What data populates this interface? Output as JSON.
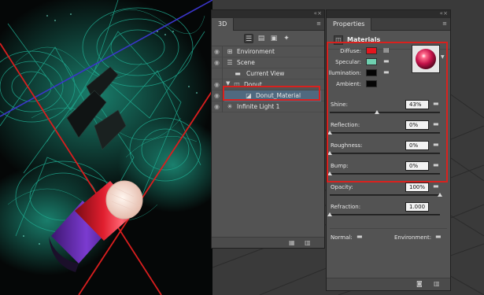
{
  "viewport": {
    "accent_colors": {
      "wire": "#1f9b84",
      "glow": "#2be0bf",
      "axis_red": "#d81e1e",
      "axis_blue": "#3a35c9",
      "can_red": "#d61f30",
      "can_purple": "#6a2db3",
      "cap": "#f1d9cf"
    }
  },
  "panel3d": {
    "tab_label": "3D",
    "collapse_glyph": "«",
    "close_glyph": "×",
    "menu_glyph": "≡",
    "toolbar": [
      {
        "icon": "scene-filter-icon",
        "glyph": "☰",
        "active": true
      },
      {
        "icon": "mesh-filter-icon",
        "glyph": "▤",
        "active": false
      },
      {
        "icon": "material-filter-icon",
        "glyph": "▣",
        "active": false
      },
      {
        "icon": "light-filter-icon",
        "glyph": "✦",
        "active": false
      }
    ],
    "tree": [
      {
        "label": "Environment",
        "icon": "environment-icon",
        "glyph": "⊞"
      },
      {
        "label": "Scene",
        "icon": "scene-icon",
        "glyph": "☰"
      },
      {
        "label": "Current View",
        "icon": "camera-icon",
        "glyph": "▬"
      },
      {
        "label": "Donut",
        "icon": "mesh-icon",
        "glyph": "◫",
        "expanded": true
      },
      {
        "label": "Donut_Material",
        "icon": "material-icon",
        "glyph": "◪",
        "selected": true
      },
      {
        "label": "Infinite Light 1",
        "icon": "infinite-light-icon",
        "glyph": "✳"
      }
    ],
    "footer_icons": [
      "add-light-icon",
      "delete-icon"
    ]
  },
  "properties": {
    "tab_label": "Properties",
    "section_title": "Materials",
    "section_icon": "materials-icon",
    "color_props": [
      {
        "label": "Diffuse:",
        "color": "#e5151d",
        "icon": "texture-loaded-icon"
      },
      {
        "label": "Specular:",
        "color": "#6fd0b0",
        "icon": "folder-icon"
      },
      {
        "label": "Illumination:",
        "color": "#050505",
        "icon": "folder-icon"
      },
      {
        "label": "Ambient:",
        "color": "#050505",
        "icon": ""
      }
    ],
    "sliders": [
      {
        "label": "Shine:",
        "value": "43%",
        "fraction": 0.43
      },
      {
        "label": "Reflection:",
        "value": "0%",
        "fraction": 0.0
      },
      {
        "label": "Roughness:",
        "value": "0%",
        "fraction": 0.0
      },
      {
        "label": "Bump:",
        "value": "0%",
        "fraction": 0.0
      },
      {
        "label": "Opacity:",
        "value": "100%",
        "fraction": 1.0
      },
      {
        "label": "Refraction:",
        "value": "1.000",
        "fraction": 0.0
      }
    ],
    "normal_label": "Normal:",
    "environment_label": "Environment:",
    "footer_icons": [
      "render-icon",
      "delete-icon"
    ]
  },
  "highlight_color": "#d9211e"
}
